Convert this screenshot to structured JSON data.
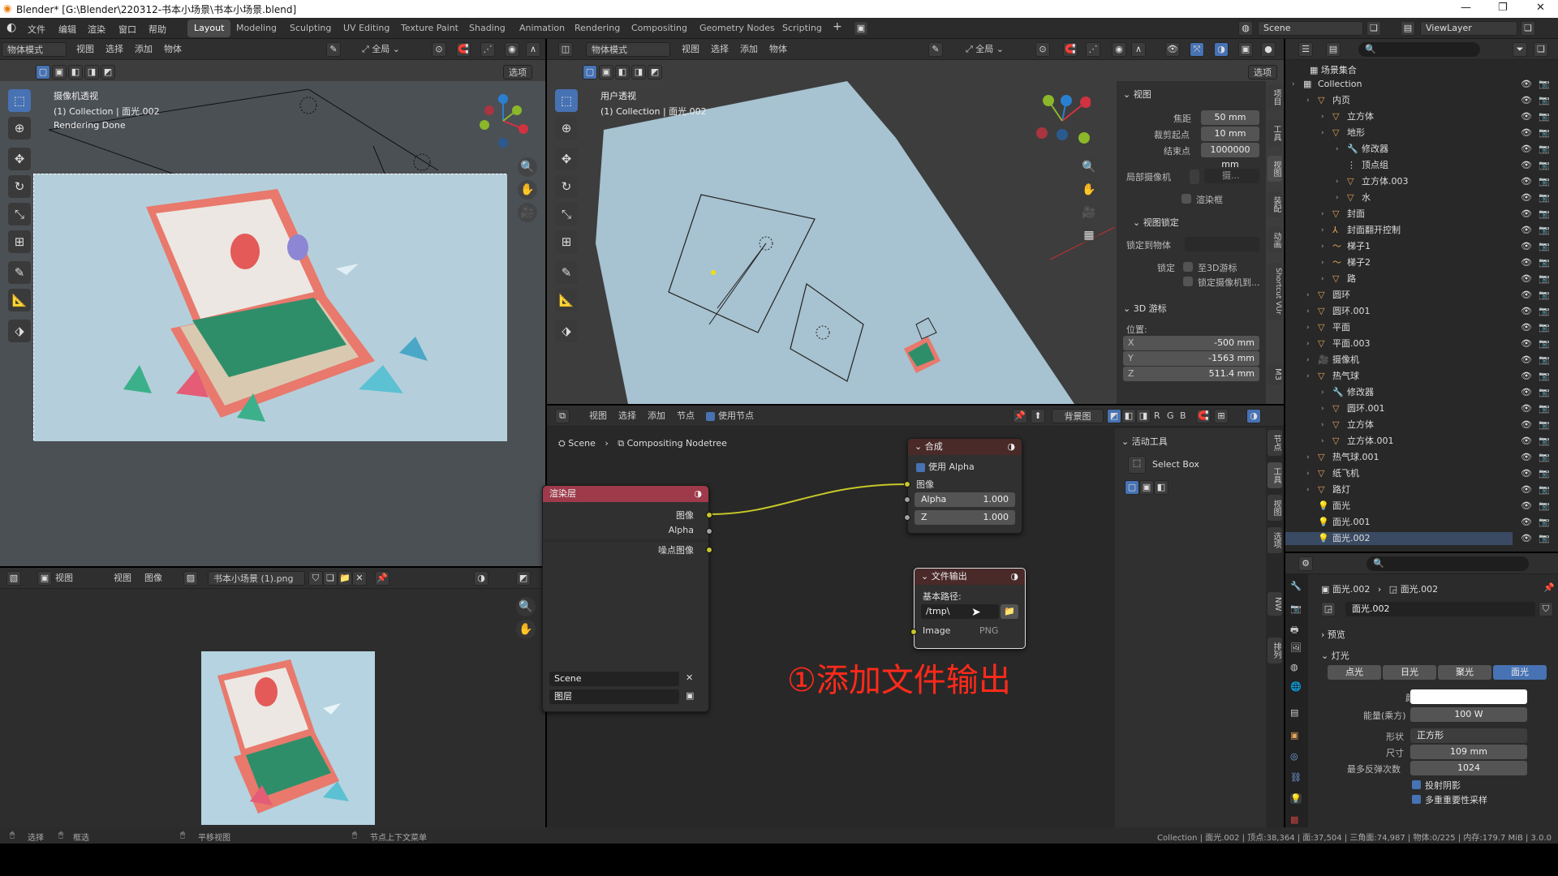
{
  "window_title": "Blender* [G:\\Blender\\220312-书本小场景\\书本小场景.blend]",
  "menu": [
    "文件",
    "编辑",
    "渲染",
    "窗口",
    "帮助"
  ],
  "workspaces": [
    "Layout",
    "Modeling",
    "Sculpting",
    "UV Editing",
    "Texture Paint",
    "Shading",
    "Animation",
    "Rendering",
    "Compositing",
    "Geometry Nodes",
    "Scripting"
  ],
  "active_workspace": "Layout",
  "scene_name": "Scene",
  "view_layer": "ViewLayer",
  "left_view": {
    "mode": "物体模式",
    "menus": [
      "视图",
      "选择",
      "添加",
      "物体"
    ],
    "orientation": "全局",
    "options": "选项",
    "overlay_title": "摄像机透视",
    "overlay_collection": "(1) Collection | 面光.002",
    "overlay_status": "Rendering Done"
  },
  "mid_view": {
    "mode": "物体模式",
    "menus": [
      "视图",
      "选择",
      "添加",
      "物体"
    ],
    "orientation": "全局",
    "options": "选项",
    "overlay_title": "用户透视",
    "overlay_collection": "(1) Collection | 面光.002"
  },
  "npanel": {
    "view_title": "视图",
    "focal_label": "焦距",
    "focal": "50 mm",
    "clip_start_label": "裁剪起点",
    "clip_start": "10 mm",
    "clip_end_label": "结束点",
    "clip_end": "1000000 mm",
    "local_camera_label": "局部摄像机",
    "local_camera_val": "摄...",
    "render_region": "渲染框",
    "view_lock": "视图锁定",
    "lock_obj_label": "锁定到物体",
    "lock_label": "锁定",
    "lock_3d": "至3D游标",
    "lock_cam": "锁定摄像机到...",
    "cursor_title": "3D 游标",
    "location_label": "位置:",
    "x_label": "X",
    "x": "-500 mm",
    "y_label": "Y",
    "y": "-1563 mm",
    "z_label": "Z",
    "z": "511.4 mm"
  },
  "n_tabs": [
    "项目",
    "工具",
    "视图",
    "装配",
    "动画",
    "Shortcut VUr",
    "M3"
  ],
  "node_tabs": [
    "节点",
    "工具",
    "视图",
    "选项",
    "NW",
    "排列"
  ],
  "image_editor": {
    "menus": [
      "视图",
      "视图",
      "图像"
    ],
    "image_name": "书本小场景 (1).png"
  },
  "node_editor": {
    "menus": [
      "视图",
      "选择",
      "添加",
      "节点"
    ],
    "use_nodes": "使用节点",
    "backdrop": "背景图",
    "channels": [
      "R",
      "G",
      "B"
    ],
    "breadcrumb_scene": "Scene",
    "breadcrumb_tree": "Compositing Nodetree",
    "active_tool_title": "活动工具",
    "active_tool": "Select Box"
  },
  "render_layer_node": {
    "title": "渲染层",
    "outputs": [
      "图像",
      "Alpha",
      "噪点图像"
    ],
    "scene": "Scene",
    "layer": "图层"
  },
  "composite_node": {
    "title": "合成",
    "use_alpha": "使用 Alpha",
    "image": "图像",
    "alpha_label": "Alpha",
    "alpha": "1.000",
    "z_label": "Z",
    "z": "1.000"
  },
  "file_output_node": {
    "title": "文件输出",
    "base_path_label": "基本路径:",
    "base_path": "/tmp\\",
    "input": "Image",
    "format": "PNG"
  },
  "annotation": "①添加文件输出",
  "outliner": {
    "root": "场景集合",
    "rows": [
      {
        "d": 0,
        "n": "Collection",
        "t": "coll"
      },
      {
        "d": 1,
        "n": "内页",
        "t": "mesh"
      },
      {
        "d": 2,
        "n": "立方体",
        "t": "mesh"
      },
      {
        "d": 2,
        "n": "地形",
        "t": "mesh"
      },
      {
        "d": 3,
        "n": "修改器",
        "t": "mod"
      },
      {
        "d": 3,
        "n": "顶点组",
        "t": "grp"
      },
      {
        "d": 3,
        "n": "立方体.003",
        "t": "mesh"
      },
      {
        "d": 3,
        "n": "水",
        "t": "mesh"
      },
      {
        "d": 2,
        "n": "封面",
        "t": "mesh"
      },
      {
        "d": 2,
        "n": "封面翻开控制",
        "t": "arm"
      },
      {
        "d": 2,
        "n": "梯子1",
        "t": "curve"
      },
      {
        "d": 2,
        "n": "梯子2",
        "t": "curve"
      },
      {
        "d": 2,
        "n": "路",
        "t": "mesh"
      },
      {
        "d": 1,
        "n": "圆环",
        "t": "mesh"
      },
      {
        "d": 1,
        "n": "圆环.001",
        "t": "mesh"
      },
      {
        "d": 1,
        "n": "平面",
        "t": "mesh"
      },
      {
        "d": 1,
        "n": "平面.003",
        "t": "mesh"
      },
      {
        "d": 1,
        "n": "摄像机",
        "t": "cam"
      },
      {
        "d": 1,
        "n": "热气球",
        "t": "mesh"
      },
      {
        "d": 2,
        "n": "修改器",
        "t": "mod"
      },
      {
        "d": 2,
        "n": "圆环.001",
        "t": "mesh"
      },
      {
        "d": 2,
        "n": "立方体",
        "t": "mesh"
      },
      {
        "d": 2,
        "n": "立方体.001",
        "t": "mesh"
      },
      {
        "d": 1,
        "n": "热气球.001",
        "t": "mesh"
      },
      {
        "d": 1,
        "n": "纸飞机",
        "t": "mesh"
      },
      {
        "d": 1,
        "n": "路灯",
        "t": "mesh"
      },
      {
        "d": 1,
        "n": "面光",
        "t": "light"
      },
      {
        "d": 1,
        "n": "面光.001",
        "t": "light"
      },
      {
        "d": 1,
        "n": "面光.002",
        "t": "light"
      }
    ]
  },
  "properties": {
    "crumb1": "面光.002",
    "crumb2": "面光.002",
    "datablock": "面光.002",
    "preview": "预览",
    "light_section": "灯光",
    "light_types": [
      "点光",
      "日光",
      "聚光",
      "面光"
    ],
    "active_type": "面光",
    "color_label": "颜色",
    "power_label": "能量(乘方)",
    "power": "100 W",
    "shape_label": "形状",
    "shape": "正方形",
    "size_label": "尺寸",
    "size": "109 mm",
    "bounces_label": "最多反弹次数",
    "bounces": "1024",
    "shadow": "投射阴影",
    "mis": "多重重要性采样"
  },
  "status": {
    "select": "选择",
    "box": "框选",
    "pan": "平移视图",
    "context": "节点上下文菜单",
    "info": "Collection | 面光.002 | 顶点:38,364 | 面:37,504 | 三角面:74,987 | 物体:0/225 | 内存:179.7 MiB | 3.0.0"
  },
  "colors": {
    "accent": "#4772b3",
    "render_node": "#9e3a4a",
    "output_node": "#4a2929",
    "annotation": "#ff2a1a"
  }
}
